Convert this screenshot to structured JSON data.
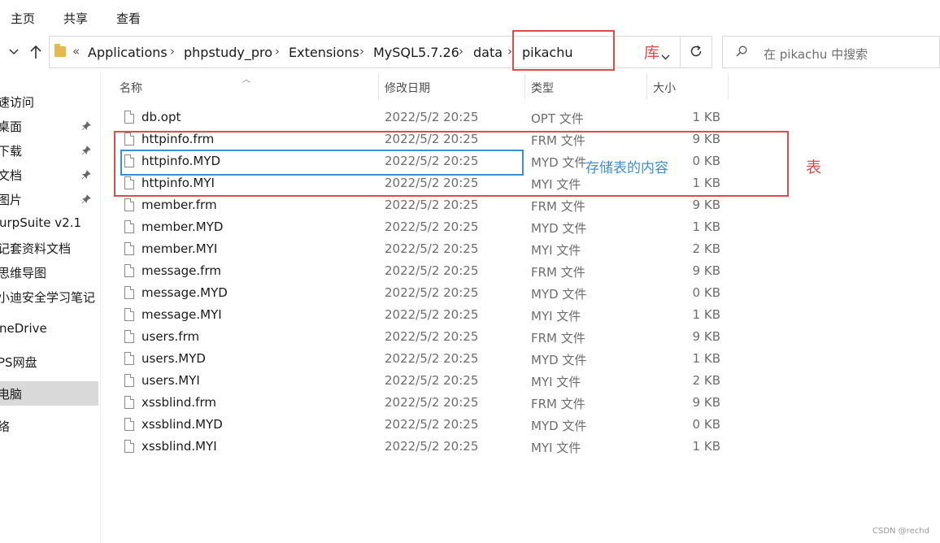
{
  "ribbon": {
    "tabs": [
      "主页",
      "共享",
      "查看"
    ]
  },
  "address": {
    "overflow": "«",
    "crumbs": [
      "Applications",
      "phpstudy_pro",
      "Extensions",
      "MySQL5.7.26",
      "data",
      "pikachu"
    ]
  },
  "search": {
    "placeholder": "在 pikachu 中搜索"
  },
  "sidebar": {
    "items": [
      {
        "label": "速访问",
        "pinned": false
      },
      {
        "label": "桌面",
        "pinned": true
      },
      {
        "label": "下载",
        "pinned": true
      },
      {
        "label": "文档",
        "pinned": true
      },
      {
        "label": "图片",
        "pinned": true
      },
      {
        "label": "urpSuite v2.1",
        "pinned": false
      },
      {
        "label": "记套资料文档",
        "pinned": false
      },
      {
        "label": "思维导图",
        "pinned": false
      },
      {
        "label": "小迪安全学习笔记",
        "pinned": false
      },
      {
        "label": "neDrive",
        "pinned": false
      },
      {
        "label": "PS网盘",
        "pinned": false
      },
      {
        "label": "电脑",
        "pinned": false
      },
      {
        "label": "络",
        "pinned": false
      }
    ]
  },
  "columns": {
    "name": "名称",
    "date": "修改日期",
    "type": "类型",
    "size": "大小"
  },
  "files": [
    {
      "name": "db.opt",
      "date": "2022/5/2 20:25",
      "type": "OPT 文件",
      "size": "1 KB"
    },
    {
      "name": "httpinfo.frm",
      "date": "2022/5/2 20:25",
      "type": "FRM 文件",
      "size": "9 KB"
    },
    {
      "name": "httpinfo.MYD",
      "date": "2022/5/2 20:25",
      "type": "MYD 文件",
      "size": "0 KB"
    },
    {
      "name": "httpinfo.MYI",
      "date": "2022/5/2 20:25",
      "type": "MYI 文件",
      "size": "1 KB"
    },
    {
      "name": "member.frm",
      "date": "2022/5/2 20:25",
      "type": "FRM 文件",
      "size": "9 KB"
    },
    {
      "name": "member.MYD",
      "date": "2022/5/2 20:25",
      "type": "MYD 文件",
      "size": "1 KB"
    },
    {
      "name": "member.MYI",
      "date": "2022/5/2 20:25",
      "type": "MYI 文件",
      "size": "2 KB"
    },
    {
      "name": "message.frm",
      "date": "2022/5/2 20:25",
      "type": "FRM 文件",
      "size": "9 KB"
    },
    {
      "name": "message.MYD",
      "date": "2022/5/2 20:25",
      "type": "MYD 文件",
      "size": "0 KB"
    },
    {
      "name": "message.MYI",
      "date": "2022/5/2 20:25",
      "type": "MYI 文件",
      "size": "1 KB"
    },
    {
      "name": "users.frm",
      "date": "2022/5/2 20:25",
      "type": "FRM 文件",
      "size": "9 KB"
    },
    {
      "name": "users.MYD",
      "date": "2022/5/2 20:25",
      "type": "MYD 文件",
      "size": "1 KB"
    },
    {
      "name": "users.MYI",
      "date": "2022/5/2 20:25",
      "type": "MYI 文件",
      "size": "2 KB"
    },
    {
      "name": "xssblind.frm",
      "date": "2022/5/2 20:25",
      "type": "FRM 文件",
      "size": "9 KB"
    },
    {
      "name": "xssblind.MYD",
      "date": "2022/5/2 20:25",
      "type": "MYD 文件",
      "size": "0 KB"
    },
    {
      "name": "xssblind.MYI",
      "date": "2022/5/2 20:25",
      "type": "MYI 文件",
      "size": "1 KB"
    }
  ],
  "annotations": {
    "db_label": "库",
    "table_label": "表",
    "myd_label": "存储表的内容"
  },
  "colors": {
    "annotation_red": "#e24a4a",
    "annotation_blue": "#3b8fd4",
    "selection": "#d9d9d9"
  },
  "watermark": "CSDN @rechd"
}
